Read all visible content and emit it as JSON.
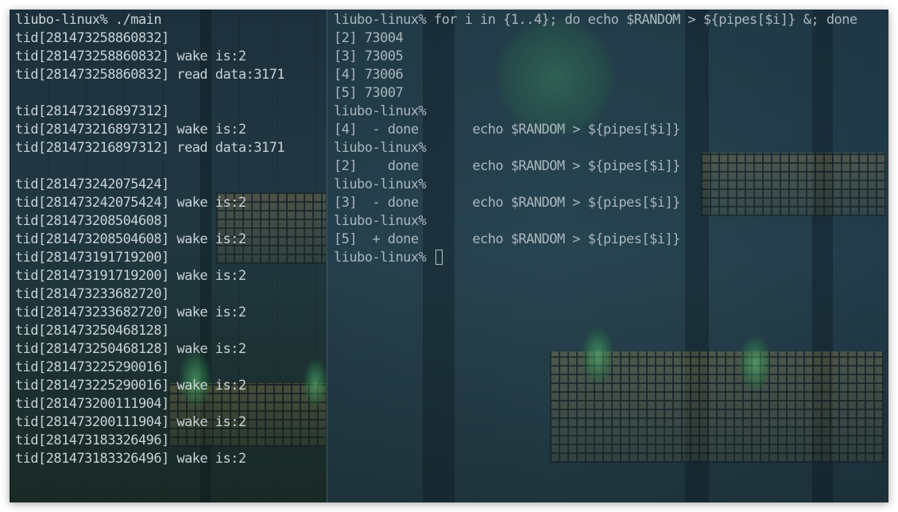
{
  "left_terminal": {
    "lines": [
      "liubo-linux% ./main",
      "tid[281473258860832]",
      "tid[281473258860832] wake is:2",
      "tid[281473258860832] read data:3171",
      "",
      "tid[281473216897312]",
      "tid[281473216897312] wake is:2",
      "tid[281473216897312] read data:3171",
      "",
      "tid[281473242075424]",
      "tid[281473242075424] wake is:2",
      "tid[281473208504608]",
      "tid[281473208504608] wake is:2",
      "tid[281473191719200]",
      "tid[281473191719200] wake is:2",
      "tid[281473233682720]",
      "tid[281473233682720] wake is:2",
      "tid[281473250468128]",
      "tid[281473250468128] wake is:2",
      "tid[281473225290016]",
      "tid[281473225290016] wake is:2",
      "tid[281473200111904]",
      "tid[281473200111904] wake is:2",
      "tid[281473183326496]",
      "tid[281473183326496] wake is:2"
    ]
  },
  "right_terminal": {
    "lines": [
      "liubo-linux% for i in {1..4}; do echo $RANDOM > ${pipes[$i]} &; done",
      "[2] 73004",
      "[3] 73005",
      "[4] 73006",
      "[5] 73007",
      "liubo-linux%",
      "[4]  - done       echo $RANDOM > ${pipes[$i]}",
      "liubo-linux%",
      "[2]    done       echo $RANDOM > ${pipes[$i]}",
      "liubo-linux%",
      "[3]  - done       echo $RANDOM > ${pipes[$i]}",
      "liubo-linux%",
      "[5]  + done       echo $RANDOM > ${pipes[$i]}"
    ],
    "prompt": "liubo-linux% "
  },
  "colors": {
    "text_left": "#c8d2d6",
    "text_right": "#a9b7bd",
    "divider": "#7896a0"
  }
}
